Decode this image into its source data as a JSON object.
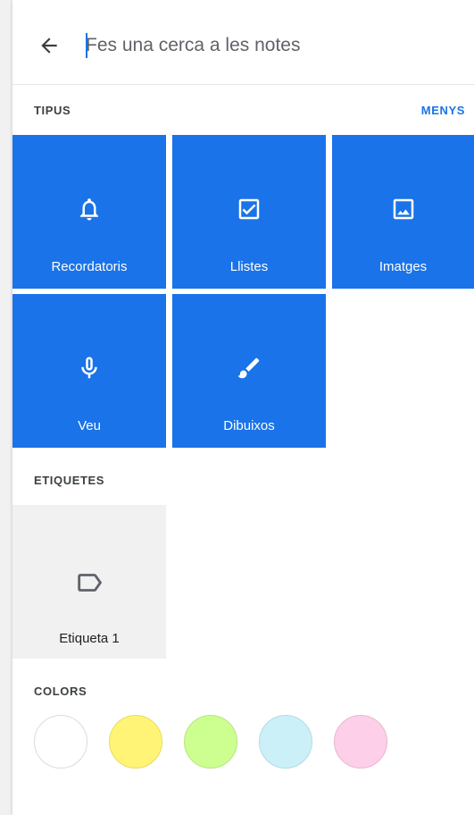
{
  "search": {
    "placeholder": "Fes una cerca a les notes",
    "back_icon": "arrow-back-icon"
  },
  "types": {
    "heading": "TIPUS",
    "toggle_label": "MENYS",
    "tile_color": "#1a73e8",
    "items": [
      {
        "label": "Recordatoris",
        "icon": "bell-icon"
      },
      {
        "label": "Llistes",
        "icon": "checkbox-icon"
      },
      {
        "label": "Imatges",
        "icon": "image-icon"
      },
      {
        "label": "Veu",
        "icon": "microphone-icon"
      },
      {
        "label": "Dibuixos",
        "icon": "brush-icon"
      }
    ]
  },
  "labels": {
    "heading": "ETIQUETES",
    "items": [
      {
        "label": "Etiqueta 1",
        "icon": "label-icon"
      }
    ]
  },
  "colors": {
    "heading": "COLORS",
    "swatches": [
      "#ffffff",
      "#fff475",
      "#ccff90",
      "#cbf0f8",
      "#fdcfe8"
    ]
  }
}
